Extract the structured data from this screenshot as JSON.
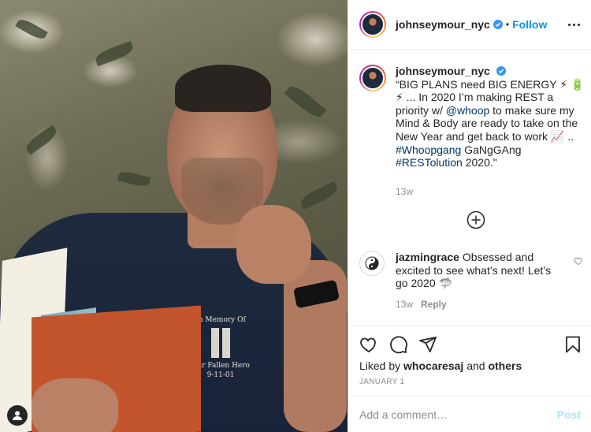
{
  "post": {
    "username": "johnseymour_nyc",
    "verified": true,
    "separator": "•",
    "follow_label": "Follow",
    "more_icon": "more-horizontal-icon"
  },
  "caption": {
    "username": "johnseymour_nyc",
    "segments": [
      {
        "type": "text",
        "value": "“BIG PLANS need BIG ENERGY ⚡ 🔋 ⚡  ... In 2020 I’m making REST a priority w/ "
      },
      {
        "type": "link",
        "value": "@whoop"
      },
      {
        "type": "text",
        "value": " to make sure my Mind & Body are ready to take on the New Year and get back to work 📈  .. "
      },
      {
        "type": "link",
        "value": "#Whoopgang"
      },
      {
        "type": "text",
        "value": " GaNgGAng "
      },
      {
        "type": "link",
        "value": "#RESTolution"
      },
      {
        "type": "text",
        "value": " 2020.\""
      }
    ],
    "timestamp": "13w"
  },
  "load_more_icon": "plus-circle-icon",
  "comments": [
    {
      "username": "jazmingrace",
      "text": "Obsessed and excited to see what’s next! Let’s go 2020 🦈",
      "timestamp": "13w",
      "reply_label": "Reply"
    }
  ],
  "actions": {
    "like_icon": "heart-icon",
    "comment_icon": "comment-icon",
    "share_icon": "share-icon",
    "save_icon": "bookmark-icon"
  },
  "likes": {
    "prefix": "Liked by",
    "user": "whocaresaj",
    "joiner": "and",
    "others": "others"
  },
  "date": "JANUARY 1",
  "comment_box": {
    "placeholder": "Add a comment…",
    "post_label": "Post"
  },
  "photo": {
    "shirt_text_1": "In Memory Of",
    "shirt_text_2": "Our Fallen Hero",
    "shirt_text_3": "9-11-01"
  },
  "colors": {
    "link": "#00376b",
    "follow": "#0095f6",
    "post_disabled": "#b2dffc",
    "muted": "#8e8e8e"
  }
}
